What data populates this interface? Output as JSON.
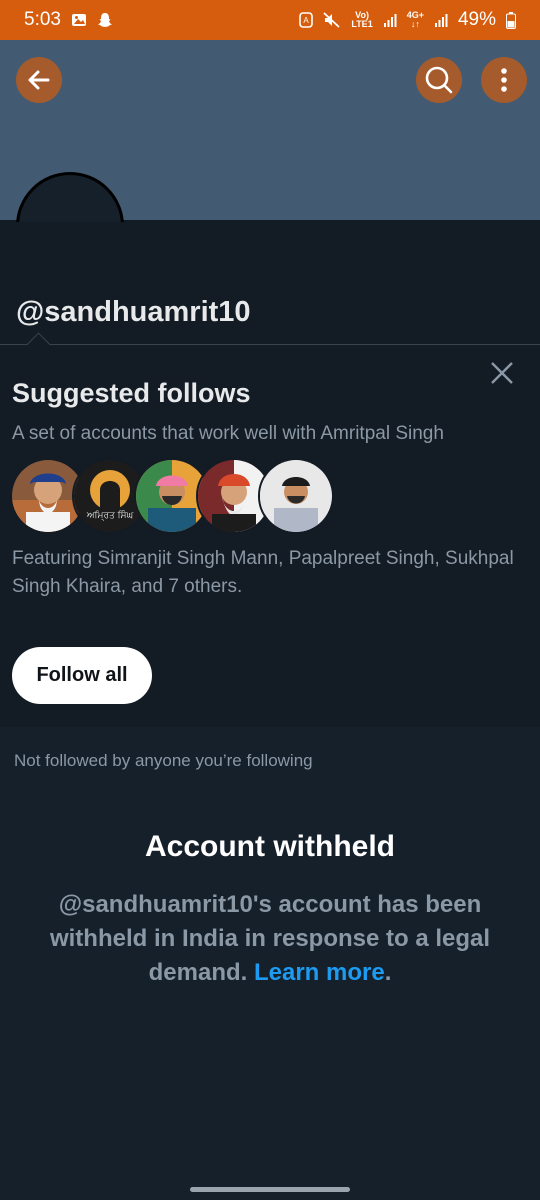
{
  "status_bar": {
    "time": "5:03",
    "network_top": "Vo)",
    "network_bottom": "LTE1",
    "network2_top": "4G+",
    "battery": "49%"
  },
  "profile": {
    "handle": "@sandhuamrit10"
  },
  "suggested": {
    "title": "Suggested follows",
    "subtitle": "A set of accounts that work well with Amritpal Singh",
    "featuring": "Featuring Simranjit Singh Mann, Papalpreet Singh, Sukhpal Singh Khaira, and 7 others.",
    "follow_all_label": "Follow all",
    "avatar_logo_text": "ਅਮ੍ਰਿਤ ਸਿੰਘ"
  },
  "not_followed": "Not followed by anyone you’re following",
  "withheld": {
    "title": "Account withheld",
    "body": "@sandhuamrit10's account has been withheld in India in response to a legal demand.",
    "link": "Learn more",
    "period": "."
  },
  "colors": {
    "status_bar": "#d65d0e",
    "banner": "#435b72",
    "background": "#15202b",
    "accent": "#1d9bf0"
  }
}
